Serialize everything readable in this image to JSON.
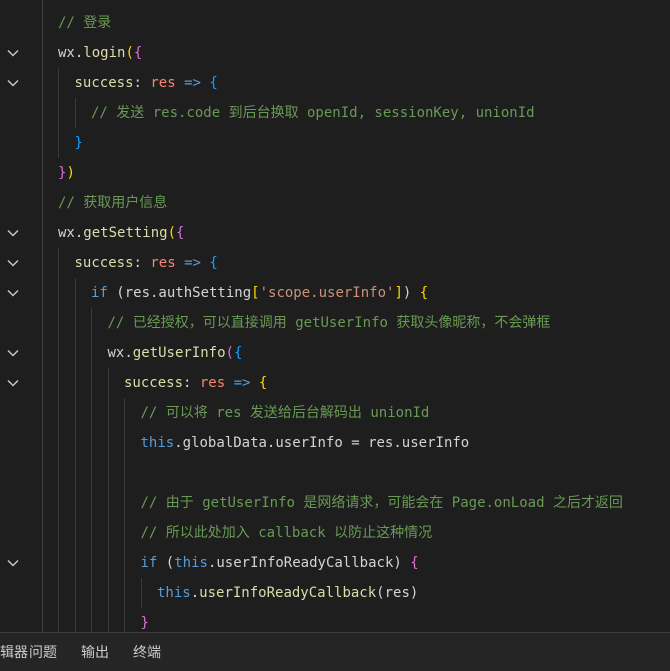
{
  "editor": {
    "lines": [
      {
        "indent": 0,
        "fold": false,
        "tokens": [
          {
            "t": "// 登录",
            "c": "cm"
          }
        ]
      },
      {
        "indent": 0,
        "fold": true,
        "tokens": [
          {
            "t": "wx.",
            "c": "pl"
          },
          {
            "t": "login",
            "c": "fn"
          },
          {
            "t": "(",
            "c": "p1"
          },
          {
            "t": "{",
            "c": "p2"
          }
        ]
      },
      {
        "indent": 1,
        "fold": true,
        "tokens": [
          {
            "t": "success",
            "c": "fn"
          },
          {
            "t": ": ",
            "c": "pl"
          },
          {
            "t": "res",
            "c": "pm"
          },
          {
            "t": " => ",
            "c": "kw"
          },
          {
            "t": "{",
            "c": "p3"
          }
        ]
      },
      {
        "indent": 2,
        "fold": false,
        "tokens": [
          {
            "t": "// 发送 res.code 到后台换取 openId, sessionKey, unionId",
            "c": "cm"
          }
        ]
      },
      {
        "indent": 1,
        "fold": false,
        "tokens": [
          {
            "t": "}",
            "c": "p3"
          }
        ]
      },
      {
        "indent": 0,
        "fold": false,
        "tokens": [
          {
            "t": "}",
            "c": "p2"
          },
          {
            "t": ")",
            "c": "p1"
          }
        ]
      },
      {
        "indent": 0,
        "fold": false,
        "tokens": [
          {
            "t": "// 获取用户信息",
            "c": "cm"
          }
        ]
      },
      {
        "indent": 0,
        "fold": true,
        "tokens": [
          {
            "t": "wx.",
            "c": "pl"
          },
          {
            "t": "getSetting",
            "c": "fn"
          },
          {
            "t": "(",
            "c": "p1"
          },
          {
            "t": "{",
            "c": "p2"
          }
        ]
      },
      {
        "indent": 1,
        "fold": true,
        "tokens": [
          {
            "t": "success",
            "c": "fn"
          },
          {
            "t": ": ",
            "c": "pl"
          },
          {
            "t": "res",
            "c": "pm"
          },
          {
            "t": " => ",
            "c": "kw"
          },
          {
            "t": "{",
            "c": "p3"
          }
        ]
      },
      {
        "indent": 2,
        "fold": true,
        "tokens": [
          {
            "t": "if",
            "c": "kw"
          },
          {
            "t": " (",
            "c": "pl"
          },
          {
            "t": "res.authSetting",
            "c": "pl"
          },
          {
            "t": "[",
            "c": "p1"
          },
          {
            "t": "'scope.userInfo'",
            "c": "st"
          },
          {
            "t": "]",
            "c": "p1"
          },
          {
            "t": ") ",
            "c": "pl"
          },
          {
            "t": "{",
            "c": "p1"
          }
        ]
      },
      {
        "indent": 3,
        "fold": false,
        "tokens": [
          {
            "t": "// 已经授权，可以直接调用 getUserInfo 获取头像昵称，不会弹框",
            "c": "cm"
          }
        ]
      },
      {
        "indent": 3,
        "fold": true,
        "tokens": [
          {
            "t": "wx.",
            "c": "pl"
          },
          {
            "t": "getUserInfo",
            "c": "fn"
          },
          {
            "t": "(",
            "c": "p2"
          },
          {
            "t": "{",
            "c": "p3"
          }
        ]
      },
      {
        "indent": 4,
        "fold": true,
        "tokens": [
          {
            "t": "success",
            "c": "fn"
          },
          {
            "t": ": ",
            "c": "pl"
          },
          {
            "t": "res",
            "c": "pm"
          },
          {
            "t": " => ",
            "c": "kw"
          },
          {
            "t": "{",
            "c": "p1"
          }
        ]
      },
      {
        "indent": 5,
        "fold": false,
        "tokens": [
          {
            "t": "// 可以将 res 发送给后台解码出 unionId",
            "c": "cm"
          }
        ]
      },
      {
        "indent": 5,
        "fold": false,
        "tokens": [
          {
            "t": "this",
            "c": "kw"
          },
          {
            "t": ".globalData.userInfo = res.userInfo",
            "c": "pl"
          }
        ]
      },
      {
        "indent": 5,
        "fold": false,
        "tokens": []
      },
      {
        "indent": 5,
        "fold": false,
        "tokens": [
          {
            "t": "// 由于 getUserInfo 是网络请求，可能会在 Page.onLoad 之后才返回",
            "c": "cm"
          }
        ]
      },
      {
        "indent": 5,
        "fold": false,
        "tokens": [
          {
            "t": "// 所以此处加入 callback 以防止这种情况",
            "c": "cm"
          }
        ]
      },
      {
        "indent": 5,
        "fold": true,
        "tokens": [
          {
            "t": "if",
            "c": "kw"
          },
          {
            "t": " (",
            "c": "pl"
          },
          {
            "t": "this",
            "c": "kw"
          },
          {
            "t": ".userInfoReadyCallback) ",
            "c": "pl"
          },
          {
            "t": "{",
            "c": "p2"
          }
        ]
      },
      {
        "indent": 6,
        "fold": false,
        "tokens": [
          {
            "t": "this",
            "c": "kw"
          },
          {
            "t": ".",
            "c": "pl"
          },
          {
            "t": "userInfoReadyCallback",
            "c": "fn"
          },
          {
            "t": "(res)",
            "c": "pl"
          }
        ]
      },
      {
        "indent": 5,
        "fold": false,
        "tokens": [
          {
            "t": "}",
            "c": "p2"
          }
        ]
      }
    ]
  },
  "panel": {
    "tabs": [
      {
        "label": "编辑器",
        "name": "tab-editor"
      },
      {
        "label": "问题",
        "name": "tab-problems"
      },
      {
        "label": "输出",
        "name": "tab-output"
      },
      {
        "label": "终端",
        "name": "tab-terminal"
      }
    ]
  },
  "icons": {
    "fold": "chevron-down-icon"
  },
  "colors": {
    "background": "#1e1e1e",
    "comment": "#6a9955",
    "keyword": "#569cd6",
    "function": "#dcdcaa",
    "parameter": "#f48771",
    "string": "#ce9178",
    "text": "#d4d4d4",
    "panel_bg": "#252526"
  }
}
